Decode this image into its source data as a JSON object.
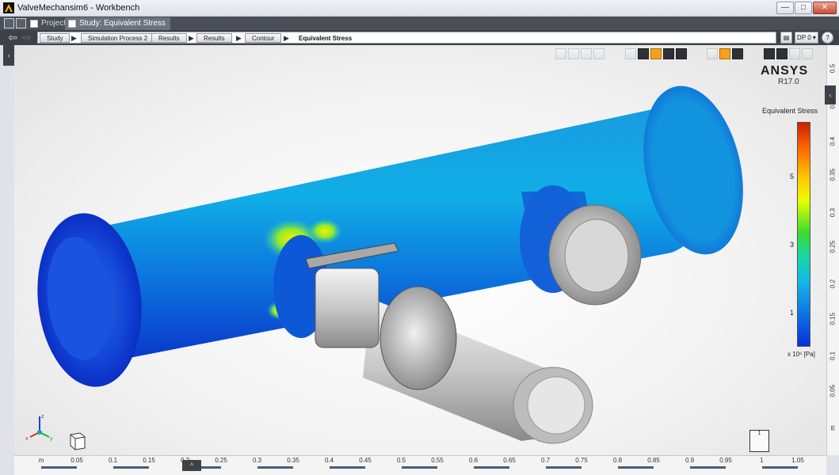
{
  "window": {
    "title": "ValveMechansim6 - Workbench",
    "controls": {
      "minimize": "—",
      "maximize": "□",
      "close": "✕"
    }
  },
  "tabs": [
    {
      "label": "Project",
      "active": false
    },
    {
      "label": "Study: Equivalent Stress",
      "active": true
    }
  ],
  "breadcrumb": {
    "items": [
      "Study",
      "Simulation Process 2",
      "Results",
      "Results",
      "Contour"
    ],
    "current": "Equivalent Stress",
    "design_point": "DP 0 ▾",
    "help": "?"
  },
  "brand": {
    "name": "ANSYS",
    "version": "R17.0"
  },
  "legend": {
    "title": "Equivalent Stress",
    "ticks": [
      "5",
      "3",
      "1"
    ],
    "unit": "x 10⁶ [Pa]",
    "colors": {
      "max": "#c82200",
      "mid": "#3fdc2a",
      "min": "#0a2fd8"
    }
  },
  "ruler_bottom": {
    "unit": "m",
    "labels": [
      "0.05",
      "0.1",
      "0.15",
      "0.2",
      "0.25",
      "0.3",
      "0.35",
      "0.4",
      "0.45",
      "0.5",
      "0.55",
      "0.6",
      "0.65",
      "0.7",
      "0.75",
      "0.8",
      "0.85",
      "0.9",
      "0.95",
      "1",
      "1.05"
    ]
  },
  "ruler_right": {
    "labels": [
      "0.5",
      "0.45",
      "0.4",
      "0.35",
      "0.3",
      "0.25",
      "0.2",
      "0.15",
      "0.1",
      "0.05",
      "m"
    ]
  },
  "triad": {
    "x": "x",
    "y": "y",
    "z": "z"
  },
  "snapshot": {
    "label": "1"
  },
  "toolbar_icons": [
    "zoom-box-icon",
    "zoom-in-icon",
    "zoom-out-icon",
    "pan-icon",
    "view-front-icon",
    "view-iso-icon",
    "view-top-icon",
    "view-side-icon",
    "view-persp-icon",
    "light-icon",
    "select-icon",
    "fit-icon",
    "pointer-icon",
    "edge-icon",
    "mesh-icon",
    "probe-icon"
  ]
}
